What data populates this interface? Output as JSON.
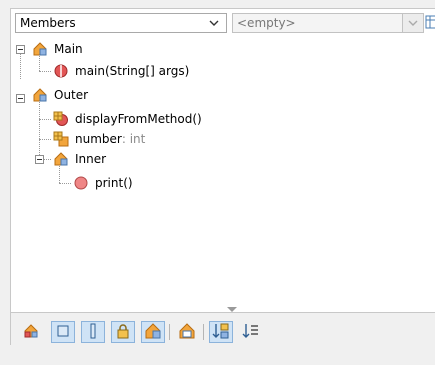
{
  "navigator": {
    "view_combo": {
      "selected": "Members"
    },
    "filter_combo": {
      "selected": "<empty>"
    }
  },
  "tree": {
    "nodes": [
      {
        "label": "Main",
        "icon": "class-icon",
        "expanded": true
      },
      {
        "label": "main(String[] args)",
        "icon": "static-method-icon"
      },
      {
        "label": "Outer",
        "icon": "class-icon",
        "expanded": true
      },
      {
        "label": "displayFromMethod()",
        "icon": "package-method-icon"
      },
      {
        "label": "number",
        "type": " : int",
        "icon": "package-field-icon"
      },
      {
        "label": "Inner",
        "icon": "class-icon",
        "expanded": true
      },
      {
        "label": "print()",
        "icon": "private-method-icon"
      }
    ]
  },
  "toolbar": {
    "buttons": [
      {
        "icon": "show-inherited-icon",
        "toggled": false
      },
      {
        "icon": "filter-fields-icon",
        "toggled": true
      },
      {
        "icon": "filter-static-icon",
        "toggled": true
      },
      {
        "icon": "filter-nonpublic-icon",
        "toggled": true
      },
      {
        "icon": "filter-inner-classes-icon",
        "toggled": true
      },
      {
        "icon": "show-fqn-icon",
        "toggled": false
      },
      {
        "icon": "sort-by-name-icon",
        "toggled": true
      },
      {
        "icon": "sort-by-source-icon",
        "toggled": false
      }
    ]
  },
  "colors": {
    "class_orange": "#f2a53c",
    "method_red": "#e25656",
    "toggle_bg": "#cfe3f6"
  }
}
